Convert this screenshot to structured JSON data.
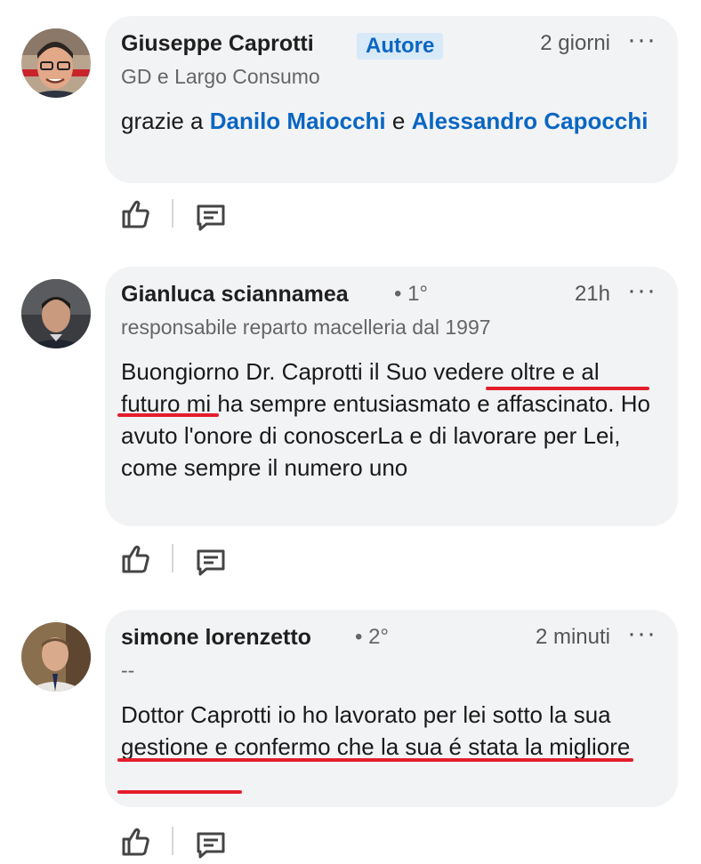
{
  "comments": [
    {
      "author": "Giuseppe Caprotti",
      "badge": "Autore",
      "degree": "",
      "time": "2 giorni",
      "more": "···",
      "subtitle": "GD e Largo Consumo",
      "text_parts": [
        "grazie a ",
        "Danilo Maiocchi",
        " e ",
        "Alessandro Capocchi"
      ],
      "avatar_icon": "person-avatar"
    },
    {
      "author": "Gianluca sciannamea",
      "badge": "",
      "degree": "• 1°",
      "time": "21h",
      "more": "···",
      "subtitle": "responsabile reparto macelleria dal 1997",
      "text": "Buongiorno Dr. Caprotti il Suo vedere oltre e al futuro mi ha sempre entusiasmato e affascinato. Ho avuto l'onore di conoscerLa e di lavorare per Lei, come sempre il numero uno",
      "avatar_icon": "person-avatar"
    },
    {
      "author": "simone lorenzetto",
      "badge": "",
      "degree": "• 2°",
      "time": "2 minuti",
      "more": "···",
      "subtitle": "--",
      "text": "Dottor Caprotti io ho lavorato per lei sotto la sua gestione e confermo che la sua é stata la migliore",
      "avatar_icon": "person-avatar"
    }
  ],
  "actions": {
    "like_icon": "thumbs-up-icon",
    "reply_icon": "comment-icon"
  },
  "colors": {
    "bubble": "#f2f3f5",
    "link": "#0a66c2",
    "underline": "#e41e2b"
  }
}
